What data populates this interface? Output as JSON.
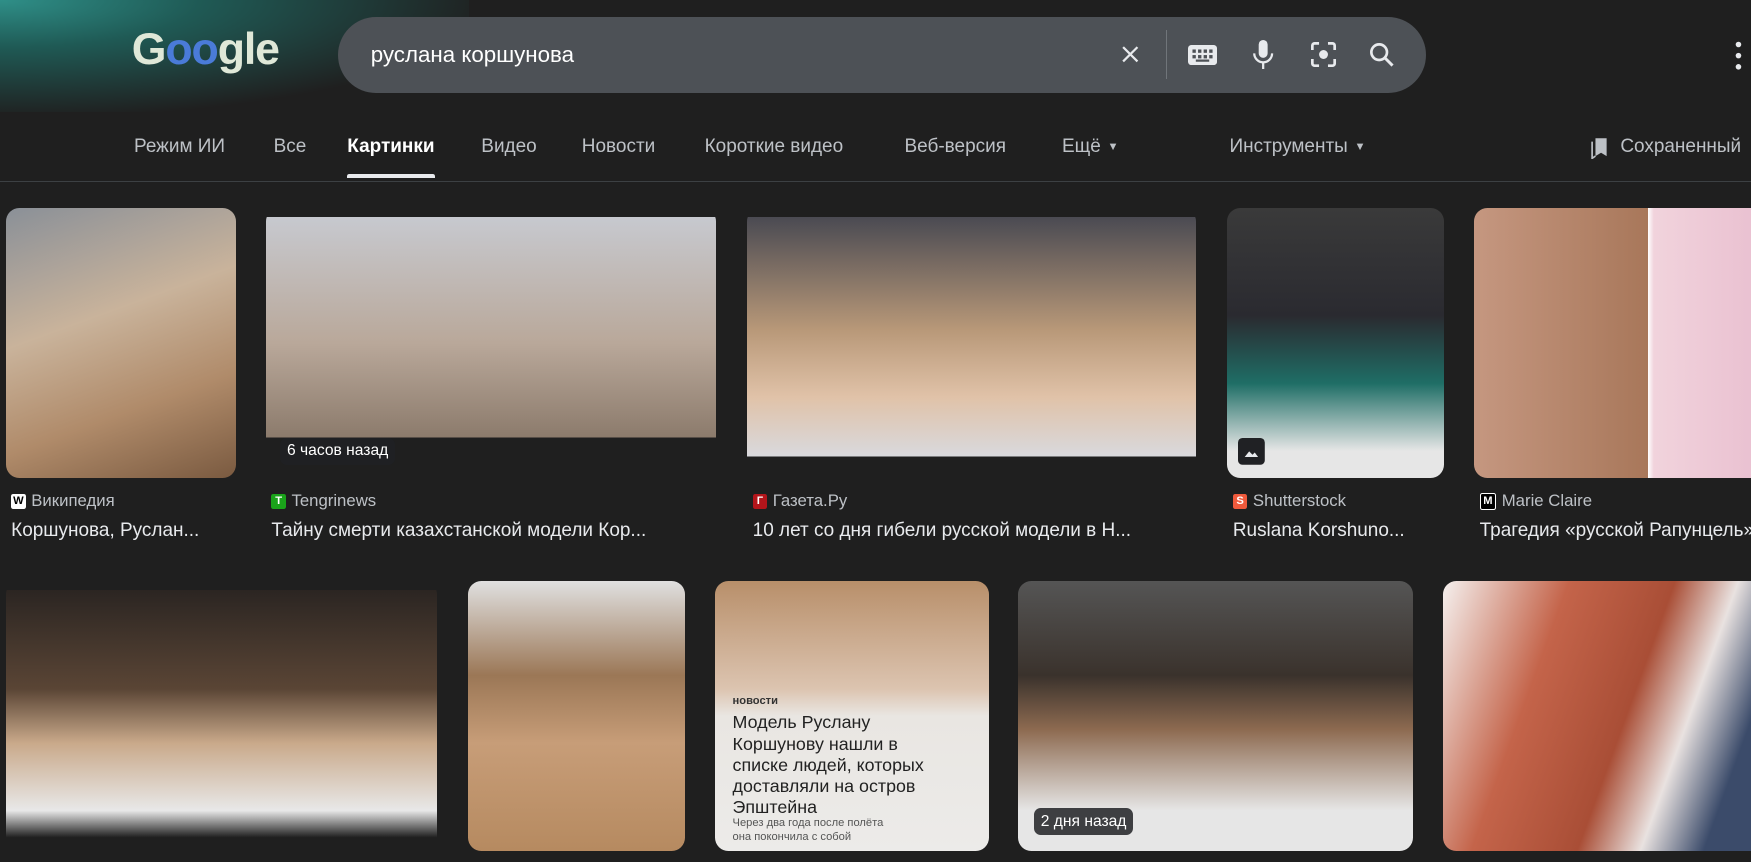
{
  "header": {
    "logo": "Google",
    "query": "руслана коршунова"
  },
  "tabs": [
    {
      "label": "Режим ИИ"
    },
    {
      "label": "Все"
    },
    {
      "label": "Картинки",
      "active": true
    },
    {
      "label": "Видео"
    },
    {
      "label": "Новости"
    },
    {
      "label": "Короткие видео"
    },
    {
      "label": "Веб-версия"
    },
    {
      "label": "Ещё"
    }
  ],
  "tools_label": "Инструменты",
  "saved_label": "Сохраненный",
  "results_row1": [
    {
      "source": "Википедия",
      "title": "Коршунова, Руслан...",
      "favicon": "W",
      "favicon_color": "#ffffff"
    },
    {
      "source": "Tengrinews",
      "title": "Тайну смерти казахстанской модели Кор...",
      "favicon": "T",
      "favicon_color": "#1aa31a",
      "badge": "6 часов назад"
    },
    {
      "source": "Газета.Ру",
      "title": "10 лет со дня гибели русской модели в Н...",
      "favicon": "Г",
      "favicon_color": "#b3151b"
    },
    {
      "source": "Shutterstock",
      "title": "Ruslana Korshuno...",
      "favicon": "S",
      "favicon_color": "#f05a3c"
    },
    {
      "source": "Marie Claire",
      "title": "Трагедия «русской Рапунцель»",
      "favicon": "M",
      "favicon_color": "#000000"
    }
  ],
  "results_row2": [
    {},
    {},
    {
      "overlay_brand": "новости",
      "overlay_headline": "Модель Руслану Коршунову нашли в списке людей, которых доставляли на остров Эпштейна",
      "overlay_sub": "Через два года после полёта она покончила с собой"
    },
    {
      "badge": "2 дня назад"
    },
    {}
  ],
  "colors": {
    "background": "#1f1f1f",
    "search_bg": "#4d5156",
    "tab_text": "#bdc1c6",
    "active_tab": "#ffffff"
  }
}
